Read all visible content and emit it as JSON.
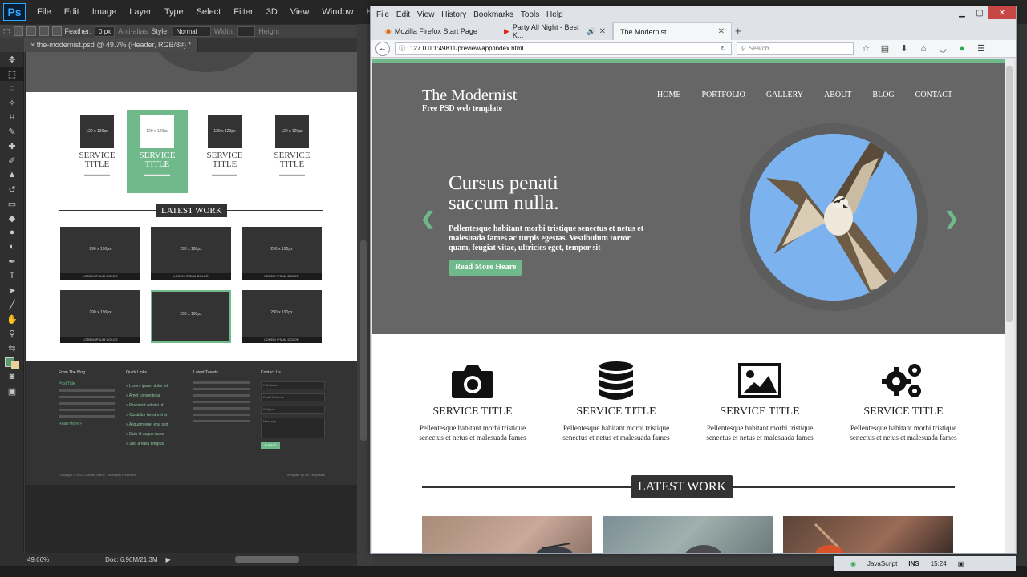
{
  "photoshop": {
    "logo": "Ps",
    "menu": [
      "File",
      "Edit",
      "Image",
      "Layer",
      "Type",
      "Select",
      "Filter",
      "3D",
      "View",
      "Window",
      "Help"
    ],
    "options": {
      "feather_label": "Feather:",
      "feather_value": "0 px",
      "antialias": "Anti-alias",
      "style_label": "Style:",
      "style_value": "Normal",
      "width_label": "Width:",
      "height_label": "Height"
    },
    "doc_tab": "× the-modernist.psd @ 49.7% (Header, RGB/8#) *",
    "status": {
      "zoom": "49.66%",
      "doc": "Doc: 6.96M/21.3M"
    },
    "design": {
      "services": [
        {
          "box": "120 x 120px",
          "title": "SERVICE TITLE"
        },
        {
          "box": "120 x 120px",
          "title": "SERVICE TITLE"
        },
        {
          "box": "120 x 120px",
          "title": "SERVICE TITLE"
        },
        {
          "box": "120 x 120px",
          "title": "SERVICE TITLE"
        }
      ],
      "latest_work": "LATEST WORK",
      "thumb_label": "290 x 190px",
      "thumb_caption": "LOREM IPSUM DOLOR",
      "footer": {
        "col1": "From The Blog",
        "col2": "Quick Links",
        "col3": "Latest Tweets",
        "col4": "Contact Us",
        "blog_title": "Post Title",
        "read_more": "Read More »",
        "links": [
          "» Lorem ipsum dolor sit",
          "» Amet consectetur",
          "» Praesent vel nisi ut",
          "» Curabitur hendrerit et",
          "» Aliquam eget erat sed",
          "» Duis id augue nunc",
          "» Sed a nulla tempus"
        ],
        "inputs": [
          "Full Name",
          "Email Address",
          "Subject",
          "Message"
        ],
        "submit": "SUBMIT",
        "copyright": "Copyright © 2015 Domain Name - All Rights Reserved",
        "credit": "Template by OS Templates"
      }
    }
  },
  "firefox": {
    "menu": [
      "File",
      "Edit",
      "View",
      "History",
      "Bookmarks",
      "Tools",
      "Help"
    ],
    "tabs": [
      {
        "label": "Mozilla Firefox Start Page"
      },
      {
        "label": "Party All Night - Best K..."
      },
      {
        "label": "The Modernist"
      }
    ],
    "url": "127.0.0.1:49811/preview/app/index.html",
    "search_placeholder": "Search"
  },
  "site": {
    "logo": "The Modernist",
    "tagline": "Free PSD web template",
    "nav": [
      "HOME",
      "PORTFOLIO",
      "GALLERY",
      "ABOUT",
      "BLOG",
      "CONTACT"
    ],
    "hero": {
      "heading_line1": "Cursus penati",
      "heading_line2": "saccum nulla.",
      "paragraph": "Pellentesque habitant morbi tristique senectus et netus et malesuada fames ac turpis egestas. Vestibulum tortor quam, feugiat vitae, ultricies eget, tempor sit",
      "button": "Read More Heare"
    },
    "services": [
      {
        "icon": "camera-icon",
        "title": "SERVICE TITLE",
        "desc": "Pellentesque habitant morbi tristique senectus et netus et malesuada fames"
      },
      {
        "icon": "database-icon",
        "title": "SERVICE TITLE",
        "desc": "Pellentesque habitant morbi tristique senectus et netus et malesuada fames"
      },
      {
        "icon": "image-icon",
        "title": "SERVICE TITLE",
        "desc": "Pellentesque habitant morbi tristique senectus et netus et malesuada fames"
      },
      {
        "icon": "gears-icon",
        "title": "SERVICE TITLE",
        "desc": "Pellentesque habitant morbi tristique senectus et netus et malesuada fames"
      }
    ],
    "latest_work": "LATEST WORK",
    "accent": "#70b98a",
    "hero_bg": "#666666"
  },
  "tray": {
    "lang": "JavaScript",
    "ins": "INS",
    "time": "15:24"
  }
}
